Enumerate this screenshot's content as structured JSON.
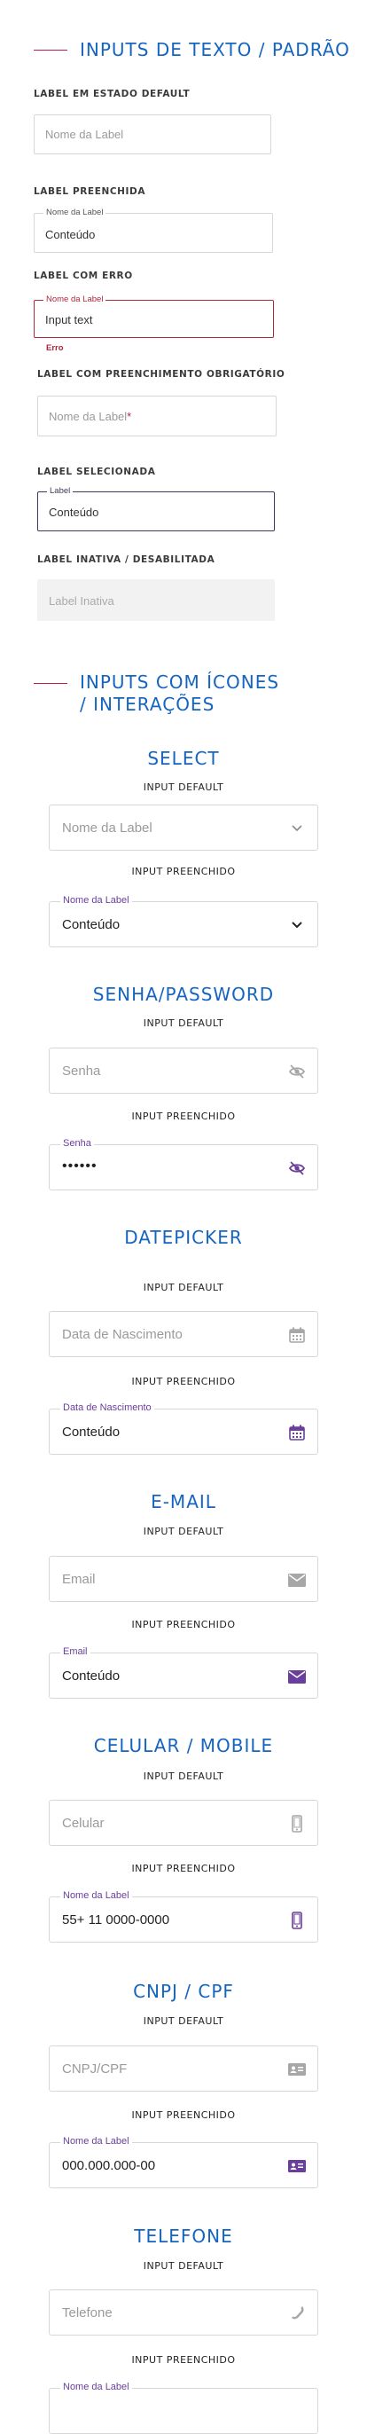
{
  "section1": {
    "title": "INPUTS DE TEXTO / PADRÃO",
    "default": {
      "heading": "LABEL EM ESTADO DEFAULT",
      "placeholder": "Nome da Label"
    },
    "filled": {
      "heading": "LABEL PREENCHIDA",
      "label": "Nome da Label",
      "value": "Conteúdo"
    },
    "error": {
      "heading": "LABEL COM ERRO",
      "label": "Nome da Label",
      "value": "Input text",
      "message": "Erro"
    },
    "required": {
      "heading": "LABEL COM PREENCHIMENTO OBRIGATÓRIO",
      "placeholder": "Nome da Label",
      "mark": "*"
    },
    "selected": {
      "heading": "LABEL SELECIONADA",
      "label": "Label",
      "value": "Conteúdo"
    },
    "disabled": {
      "heading": "LABEL INATIVA / DESABILITADA",
      "placeholder": "Label Inativa"
    }
  },
  "section2": {
    "title_line1": "INPUTS COM ÍCONES",
    "title_line2": "/ INTERAÇÕES"
  },
  "sub_default": "INPUT DEFAULT",
  "sub_filled": "INPUT PREENCHIDO",
  "groups": {
    "select": {
      "title": "SELECT",
      "placeholder": "Nome da Label",
      "label": "Nome da Label",
      "value": "Conteúdo",
      "icon": "chevron-down-icon"
    },
    "password": {
      "title": "SENHA/PASSWORD",
      "placeholder": "Senha",
      "label": "Senha",
      "value": "••••••",
      "icon": "eye-off-icon"
    },
    "date": {
      "title": "DATEPICKER",
      "placeholder": "Data de Nascimento",
      "label": "Data de Nascimento",
      "value": "Conteúdo",
      "icon": "calendar-icon"
    },
    "email": {
      "title": "E-MAIL",
      "placeholder": "Email",
      "label": "Email",
      "value": "Conteúdo",
      "icon": "envelope-icon"
    },
    "mobile": {
      "title": "CELULAR / MOBILE",
      "placeholder": "Celular",
      "label": "Nome da Label",
      "value": "55+ 11 0000-0000",
      "icon": "mobile-phone-icon"
    },
    "cnpj": {
      "title": "CNPJ / CPF",
      "placeholder": "CNPJ/CPF",
      "label": "Nome da Label",
      "value": "000.000.000-00",
      "icon": "id-card-icon"
    },
    "phone": {
      "title": "TELEFONE",
      "placeholder": "Telefone",
      "label": "Nome da Label",
      "icon": "phone-icon"
    }
  },
  "colors": {
    "accent_blue": "#1565c0",
    "error_red": "#b0263b",
    "active_purple": "#6a3e9c",
    "icon_gray": "#a7a7a7"
  }
}
